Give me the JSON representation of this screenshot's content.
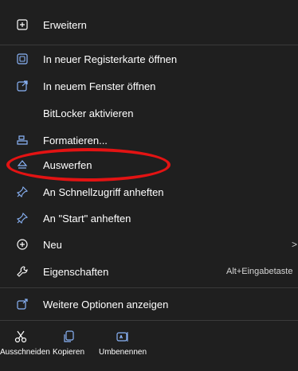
{
  "menu": {
    "items": [
      {
        "label": "Erweitern",
        "icon": "expand-plus-icon"
      },
      {
        "label": "In neuer Registerkarte öffnen",
        "icon": "open-new-tab-icon"
      },
      {
        "label": "In neuem Fenster öffnen",
        "icon": "open-new-window-icon"
      },
      {
        "label": "BitLocker aktivieren",
        "icon": ""
      },
      {
        "label": "Formatieren...",
        "icon": "format-drive-icon"
      },
      {
        "label": "Auswerfen",
        "icon": "eject-icon"
      },
      {
        "label": "An Schnellzugriff anheften",
        "icon": "pin-icon"
      },
      {
        "label": "An \"Start\" anheften",
        "icon": "pin-icon"
      },
      {
        "label": "Neu",
        "icon": "new-plus-icon",
        "chevron": ">"
      },
      {
        "label": "Eigenschaften",
        "icon": "wrench-icon",
        "shortcut": "Alt+Eingabetaste"
      },
      {
        "label": "Weitere Optionen anzeigen",
        "icon": "more-options-icon"
      }
    ]
  },
  "bottom_bar": {
    "cut": "Ausschneiden",
    "copy": "Kopieren",
    "rename": "Umbenennen"
  },
  "colors": {
    "background": "#1f1f1f",
    "text": "#ffffff",
    "icon_blue": "#8ab4f8",
    "annotation_red": "#e31313"
  }
}
